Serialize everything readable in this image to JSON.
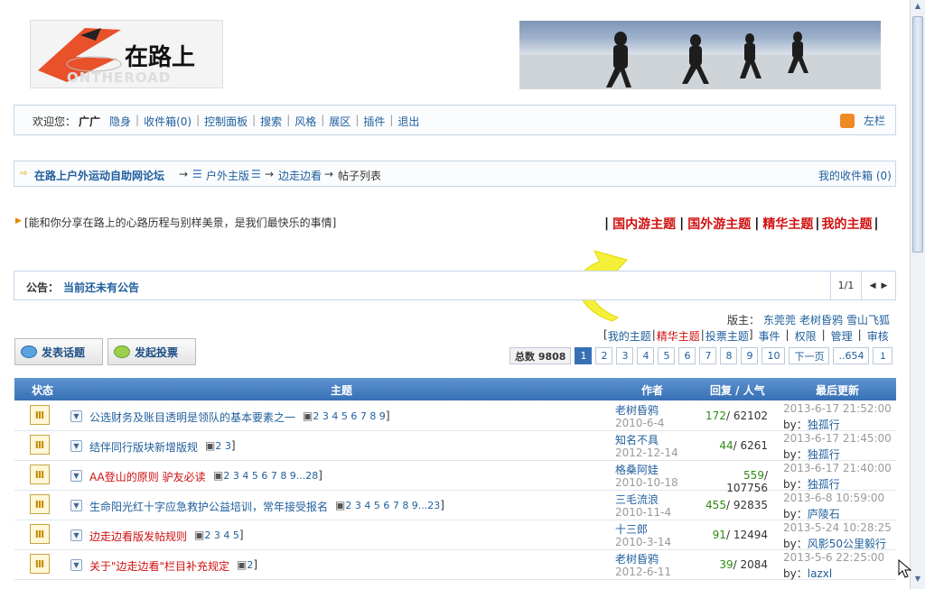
{
  "header": {
    "logo_text": "在路上",
    "logo_sub": "ONTHEROAD"
  },
  "welcome": {
    "greeting": "欢迎您：",
    "user": "广广",
    "links": [
      "隐身",
      "收件箱(0)",
      "控制面板",
      "搜索",
      "风格",
      "展区",
      "插件",
      "退出"
    ],
    "sidebar": "左栏"
  },
  "breadcrumb": {
    "forum": "在路上户外运动自助网论坛",
    "section": "户外主版",
    "board": "边走边看",
    "current": "帖子列表",
    "inbox": "我的收件箱 (0)"
  },
  "tagline": "[能和你分享在路上的心路历程与别样美景，是我们最快乐的事情]",
  "theme_links": [
    "国内游主题",
    "国外游主题",
    "精华主题",
    "我的主题"
  ],
  "notice": {
    "label": "公告：",
    "text": "当前还未有公告",
    "page": "1/1"
  },
  "moderators": {
    "label": "版主：",
    "names": [
      "东莞莞",
      "老树昏鸦",
      "雪山飞狐"
    ]
  },
  "filters": {
    "open": "[",
    "my_topics": "我的主题",
    "essence": "精华主题",
    "vote": "投票主题",
    "close": "]",
    "events": "事件",
    "permissions": "权限",
    "manage": "管理",
    "review": "审核"
  },
  "actions": {
    "post": "发表话题",
    "vote": "发起投票"
  },
  "pagination": {
    "total": "总数 9808",
    "pages": [
      "1",
      "2",
      "3",
      "4",
      "5",
      "6",
      "7",
      "8",
      "9",
      "10"
    ],
    "next": "下一页",
    "last": "..654",
    "jump_value": "1"
  },
  "table": {
    "headers": [
      "状态",
      "主题",
      "作者",
      "回复 / 人气",
      "最后更新"
    ],
    "rows": [
      {
        "title": "公选财务及账目透明是领队的基本要素之一",
        "title_color": "#1f5e9c",
        "pages": "2 3 4 5 6 7 8 9",
        "author": "老树昏鸦",
        "date": "2010-6-4",
        "replies": "172",
        "views": "62102",
        "last_time": "2013-6-17 21:52:00",
        "last_by": "独孤行",
        "status_icon": "hot-topic-icon"
      },
      {
        "title": "结伴同行版块新增版规",
        "title_color": "#1f5e9c",
        "pages": "2 3",
        "author": "知名不具",
        "date": "2012-12-14",
        "replies": "44",
        "views": "6261",
        "last_time": "2013-6-17 21:45:00",
        "last_by": "独孤行",
        "status_icon": "hot-topic-icon"
      },
      {
        "title": "AA登山的原则 驴友必读",
        "title_color": "#d01010",
        "pages": "2 3 4 5 6 7 8 9...28",
        "author": "格桑阿娃",
        "date": "2010-10-18",
        "replies": "559",
        "views": "107756",
        "last_time": "2013-6-17 21:40:00",
        "last_by": "独孤行",
        "status_icon": "hot-topic-icon"
      },
      {
        "title": "生命阳光红十字应急救护公益培训，常年接受报名",
        "title_color": "#1f5e9c",
        "pages": "2 3 4 5 6 7 8 9...23",
        "author": "三毛流浪",
        "date": "2010-11-4",
        "replies": "455",
        "views": "92835",
        "last_time": "2013-6-8 10:59:00",
        "last_by": "庐陵石",
        "status_icon": "hot-topic-icon"
      },
      {
        "title": "边走边看版发帖规则",
        "title_color": "#d01010",
        "pages": "2 3 4 5",
        "author": "十三郎",
        "date": "2010-3-14",
        "replies": "91",
        "views": "12494",
        "last_time": "2013-5-24 10:28:25",
        "last_by": "风影50公里毅行",
        "status_icon": "topic-icon"
      },
      {
        "title": "关于\"边走边看\"栏目补充规定",
        "title_color": "#d01010",
        "pages": "2",
        "author": "老树昏鸦",
        "date": "2012-6-11",
        "replies": "39",
        "views": "2084",
        "last_time": "2013-5-6 22:25:00",
        "last_by": "lazxl",
        "status_icon": "topic-icon"
      }
    ],
    "by_label": "by："
  },
  "colors": {
    "accent": "#3870b6",
    "red": "#d01010",
    "green": "#2e8b13"
  }
}
